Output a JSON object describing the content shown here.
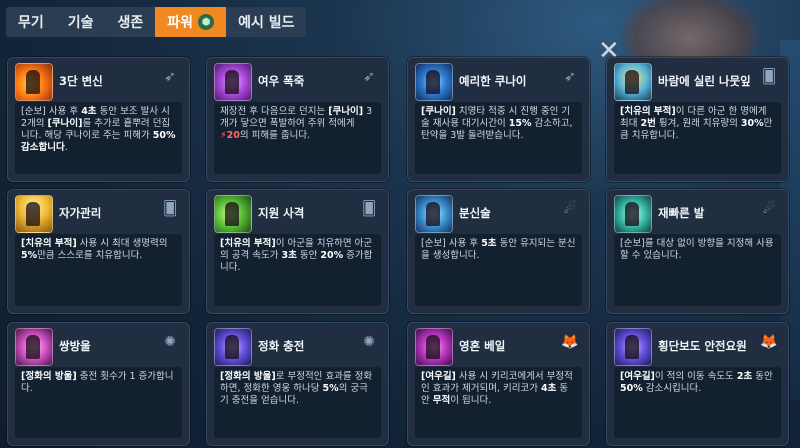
{
  "tabs": [
    {
      "label": "무기",
      "active": false
    },
    {
      "label": "기술",
      "active": false
    },
    {
      "label": "생존",
      "active": false
    },
    {
      "label": "파워",
      "active": true
    },
    {
      "label": "예시 빌드",
      "active": false
    }
  ],
  "cards": [
    {
      "title": "3단 변신",
      "badge_icon": "kunai-icon",
      "desc": [
        "[순보] 사용 후 ",
        {
          "b": "4초"
        },
        " 동안 보조 발사 시 2개의 ",
        {
          "b": "[쿠나이]"
        },
        "를 추가로 흩뿌려 던집니다. 해당 쿠나이로 주는 피해가 ",
        {
          "b": "50% 감소합니다"
        },
        "."
      ]
    },
    {
      "title": "여우 폭죽",
      "badge_icon": "kunai-icon",
      "desc": [
        "재장전 후 다음으로 던지는 ",
        {
          "b": "[쿠나이]"
        },
        " 3개가 닿으면 폭발하여 주위 적에게 ",
        {
          "r": "20"
        },
        "의 피해를 줍니다."
      ]
    },
    {
      "title": "예리한 쿠나이",
      "badge_icon": "kunai-icon",
      "desc": [
        {
          "b": "[쿠나이]"
        },
        " 치명타 적중 시 진행 중인 기술 재사용 대기시간이 ",
        {
          "b": "15%"
        },
        " 감소하고, 탄약을 3발 돌려받습니다."
      ]
    },
    {
      "title": "바람에 실린 나뭇잎",
      "badge_icon": "cards-icon",
      "desc": [
        {
          "b": "[치유의 부적]"
        },
        "이 다른 아군 한 명에게 최대 ",
        {
          "b": "2번"
        },
        " 튕겨, 원래 치유량의 ",
        {
          "b": "30%"
        },
        "만큼 치유합니다."
      ]
    },
    {
      "title": "자가관리",
      "badge_icon": "cards-icon",
      "desc": [
        {
          "b": "[치유의 부적]"
        },
        " 사용 시 최대 생명력의 ",
        {
          "b": "5%"
        },
        "만큼 스스로를 치유합니다."
      ]
    },
    {
      "title": "지원 사격",
      "badge_icon": "cards-icon",
      "desc": [
        {
          "b": "[치유의 부적]"
        },
        "이 아군을 치유하면 아군의 공격 속도가 ",
        {
          "b": "3초"
        },
        " 동안 ",
        {
          "b": "20%"
        },
        " 증가합니다."
      ]
    },
    {
      "title": "분신술",
      "badge_icon": "dash-icon",
      "desc": [
        "[순보] 사용 후 ",
        {
          "b": "5초"
        },
        " 동안 유지되는 분신을 생성합니다."
      ]
    },
    {
      "title": "재빠른 발",
      "badge_icon": "dash-icon",
      "desc": [
        "[순보]를 대상 없이 방향을 지정해 사용할 수 있습니다."
      ]
    },
    {
      "title": "쌍방울",
      "badge_icon": "swirl-icon",
      "desc": [
        {
          "b": "[정화의 방울]"
        },
        " 충전 횟수가 1 증가합니다."
      ]
    },
    {
      "title": "정화 충전",
      "badge_icon": "swirl-icon",
      "desc": [
        {
          "b": "[정화의 방울]"
        },
        "로 부정적인 효과를 정화하면, 정화한 영웅 하나당 ",
        {
          "b": "5%"
        },
        "의 궁극기 충전을 얻습니다."
      ]
    },
    {
      "title": "영혼 베일",
      "badge_icon": "fox-icon",
      "desc": [
        {
          "b": "[여우길]"
        },
        " 사용 시 키리코에게서 부정적인 효과가 제거되며, 키리코가 ",
        {
          "b": "4초"
        },
        " 동안 ",
        {
          "b": "무적"
        },
        "이 됩니다."
      ]
    },
    {
      "title": "횡단보도 안전요원",
      "badge_icon": "fox-icon",
      "desc": [
        {
          "b": "[여우길]"
        },
        "이 적의 이동 속도도 ",
        {
          "b": "2초"
        },
        " 동안 ",
        {
          "b": "50%"
        },
        " 감소시킵니다."
      ]
    }
  ]
}
